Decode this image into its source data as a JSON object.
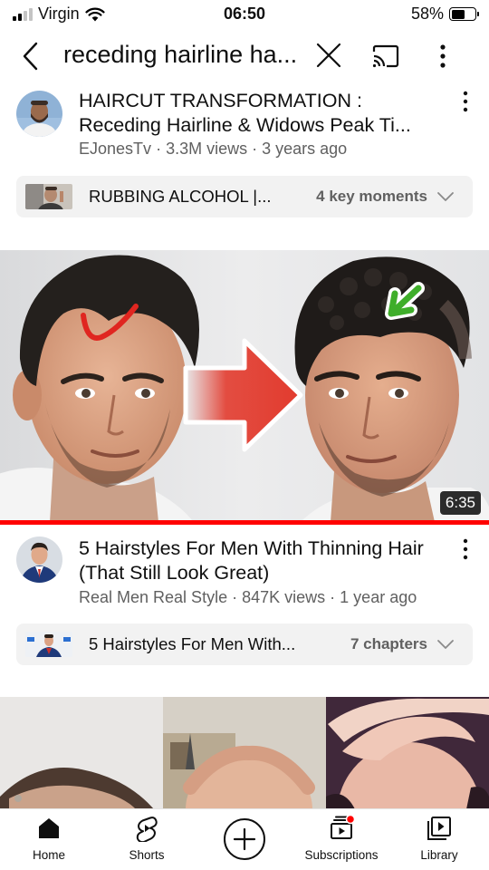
{
  "status_bar": {
    "carrier": "Virgin",
    "time": "06:50",
    "battery": "58%",
    "battery_level": 0.58
  },
  "search": {
    "query": "receding hairline ha..."
  },
  "results": [
    {
      "title": "HAIRCUT TRANSFORMATION : Receding Hairline & Widows Peak Ti...",
      "channel": "EJonesTv",
      "views": "3.3M views",
      "age": "3 years ago",
      "moments_label": "RUBBING ALCOHOL |...",
      "moments_count": "4 key moments"
    },
    {
      "title": "5 Hairstyles For Men With Thinning Hair (That Still Look Great)",
      "channel": "Real Men Real Style",
      "views": "847K views",
      "age": "1 year ago",
      "duration": "6:35",
      "moments_label": "5 Hairstyles For Men With...",
      "moments_count": "7 chapters"
    }
  ],
  "bottom_nav": {
    "home": "Home",
    "shorts": "Shorts",
    "subscriptions": "Subscriptions",
    "library": "Library"
  },
  "colors": {
    "brand_red": "#ff0000",
    "text_primary": "#0f0f0f",
    "text_secondary": "#606060",
    "chip_bg": "#f2f2f2"
  },
  "icons": [
    "back-icon",
    "clear-icon",
    "cast-icon",
    "more-vert-icon",
    "chevron-down-icon",
    "home-icon",
    "shorts-icon",
    "create-icon",
    "subscriptions-icon",
    "library-icon",
    "wifi-icon",
    "signal-icon",
    "battery-icon"
  ]
}
